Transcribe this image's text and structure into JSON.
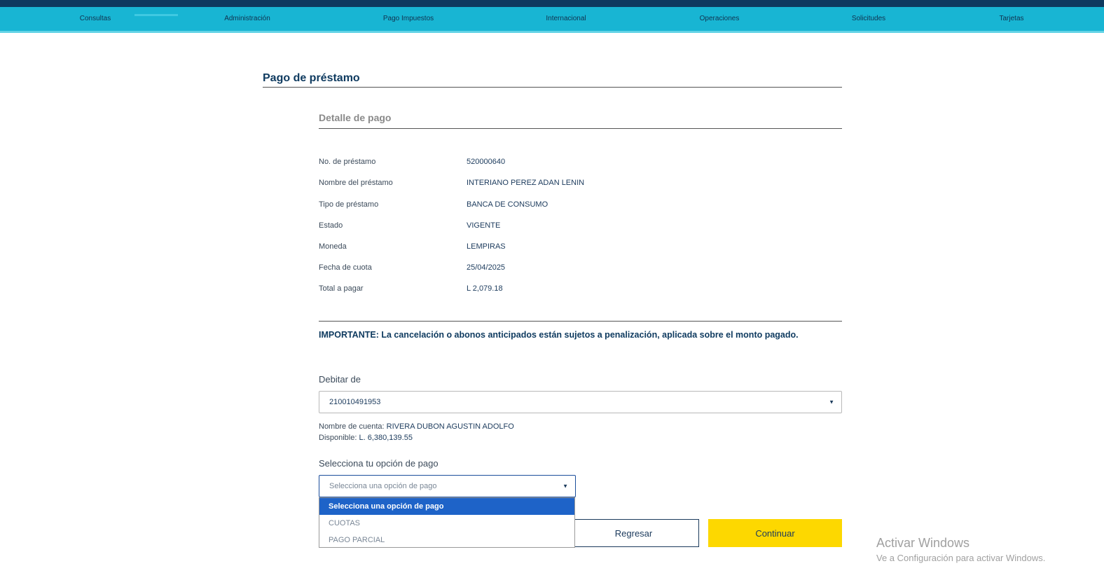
{
  "nav": {
    "items": [
      "Consultas",
      "Administración",
      "Pago Impuestos",
      "Internacional",
      "Operaciones",
      "Solicitudes",
      "Tarjetas"
    ]
  },
  "page": {
    "title": "Pago de préstamo",
    "section_title": "Detalle de pago"
  },
  "details": [
    {
      "label": "No. de préstamo",
      "value": "520000640"
    },
    {
      "label": "Nombre del préstamo",
      "value": "INTERIANO PEREZ ADAN LENIN"
    },
    {
      "label": "Tipo de préstamo",
      "value": "BANCA DE CONSUMO"
    },
    {
      "label": "Estado",
      "value": "VIGENTE"
    },
    {
      "label": "Moneda",
      "value": "LEMPIRAS"
    },
    {
      "label": "Fecha de cuota",
      "value": "25/04/2025"
    },
    {
      "label": "Total a pagar",
      "value": "L 2,079.18"
    }
  ],
  "important": "IMPORTANTE: La cancelación o abonos anticipados están sujetos a penalización, aplicada sobre el monto pagado.",
  "debit": {
    "label": "Debitar de",
    "selected": "210010491953",
    "account_name_label": "Nombre de cuenta:",
    "account_name": "RIVERA DUBON AGUSTIN ADOLFO",
    "available_label": "Disponible:",
    "available": "L. 6,380,139.55"
  },
  "payment_option": {
    "label": "Selecciona tu opción de pago",
    "placeholder": "Selecciona una opción de pago",
    "options": [
      "Selecciona una opción de pago",
      "CUOTAS",
      "PAGO PARCIAL"
    ]
  },
  "buttons": {
    "back": "Regresar",
    "continue": "Continuar"
  },
  "watermark": {
    "line1": "Activar Windows",
    "line2": "Ve a Configuración para activar Windows."
  },
  "colors": {
    "nav_bg": "#18b5d3",
    "top_bar": "#0e3a5f",
    "continue_bg": "#fdd800",
    "dropdown_selected": "#1e63c8"
  }
}
